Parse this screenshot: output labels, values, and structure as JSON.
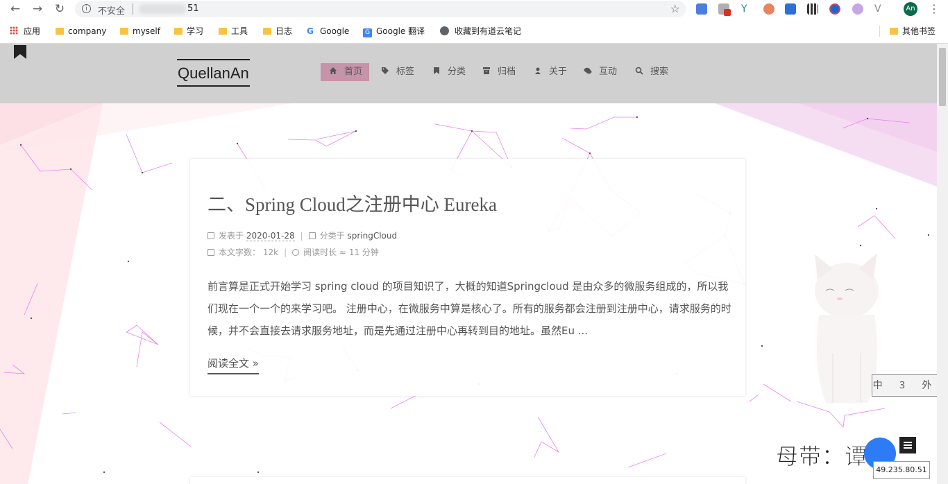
{
  "browser": {
    "security_label": "不安全",
    "url_suffix": "51",
    "avatar_initials": "An",
    "bookmarks": [
      {
        "label": "应用",
        "kind": "apps"
      },
      {
        "label": "company",
        "kind": "folder"
      },
      {
        "label": "myself",
        "kind": "folder"
      },
      {
        "label": "学习",
        "kind": "folder"
      },
      {
        "label": "工具",
        "kind": "folder"
      },
      {
        "label": "日志",
        "kind": "folder"
      },
      {
        "label": "Google",
        "kind": "google"
      },
      {
        "label": "Google 翻译",
        "kind": "translate"
      },
      {
        "label": "收藏到有道云笔记",
        "kind": "globe"
      }
    ],
    "other_bookmarks": "其他书签"
  },
  "site": {
    "brand": "QuellanAn",
    "menu": [
      {
        "label": "首页",
        "icon": "home-icon",
        "active": true
      },
      {
        "label": "标签",
        "icon": "tags-icon",
        "active": false
      },
      {
        "label": "分类",
        "icon": "bookmark-icon",
        "active": false
      },
      {
        "label": "归档",
        "icon": "archive-icon",
        "active": false
      },
      {
        "label": "关于",
        "icon": "user-icon",
        "active": false
      },
      {
        "label": "互动",
        "icon": "comments-icon",
        "active": false
      },
      {
        "label": "搜索",
        "icon": "search-icon",
        "active": false
      }
    ]
  },
  "post": {
    "title": "二、Spring Cloud之注册中心 Eureka",
    "posted_label": "发表于",
    "date": "2020-01-28",
    "category_label": "分类于",
    "category": "springCloud",
    "wordcount_label": "本文字数：",
    "wordcount": "12k",
    "readtime_label": "阅读时长 ≈",
    "readtime": "11 分钟",
    "excerpt": "前言算是正式开始学习 spring cloud 的项目知识了，大概的知道Springcloud 是由众多的微服务组成的，所以我们现在一个一个的来学习吧。 注册中心，在微服务中算是核心了。所有的服务都会注册到注册中心，请求服务的时候，并不会直接去请求服务地址，而是先通过注册中心再转到目的地址。虽然Eu ...",
    "read_more": "阅读全文 »"
  },
  "widgets": {
    "lang_switch": "中 Ꝫ 外",
    "watermark": "母带：谭聪",
    "ip": "49.235.80.51"
  }
}
